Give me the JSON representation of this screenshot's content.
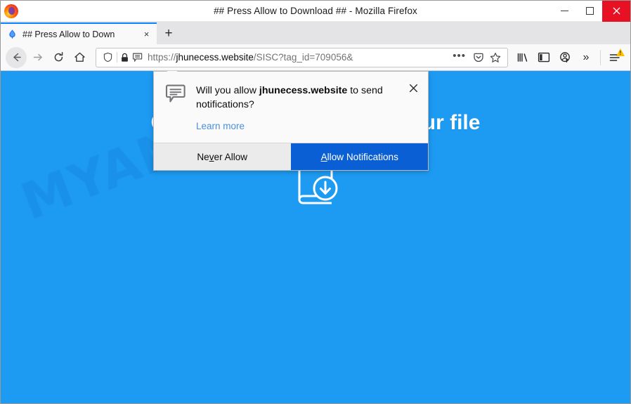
{
  "window": {
    "title": "## Press Allow to Download ## - Mozilla Firefox",
    "app_icon": "firefox-logo",
    "controls": {
      "minimize": "minimize",
      "maximize": "maximize",
      "close": "close"
    }
  },
  "tabs": {
    "items": [
      {
        "title": "## Press Allow to Down",
        "favicon": "blue-droplet-favicon",
        "close_label": "×"
      }
    ],
    "new_tab_label": "+"
  },
  "navigation": {
    "back": "back-arrow",
    "forward": "forward-arrow",
    "reload": "reload",
    "home": "home"
  },
  "urlbar": {
    "shield_icon": "tracking-protection-shield",
    "lock_icon": "padlock",
    "permission_icon": "notification-speech-bubble",
    "scheme": "https://",
    "domain": "jhunecess.website",
    "path": "/SISC?tag_id=709056&",
    "full_url": "https://jhunecess.website/SISC?tag_id=709056&",
    "page_actions": "•••",
    "pocket_icon": "pocket",
    "bookmark_icon": "star"
  },
  "toolbar_right": {
    "library": "library-icon",
    "sidebar": "sidebar-icon",
    "account": "account-sync-warning-icon",
    "overflow": "»",
    "menu": "hamburger-menu-icon",
    "menu_badge": "update-warning-badge"
  },
  "doorhanger": {
    "icon": "notification-speech-bubble",
    "question_prefix": "Will you allow ",
    "question_domain": "jhunecess.website",
    "question_suffix": " to send notifications?",
    "learn_more": "Learn more",
    "close": "×",
    "never_allow": {
      "before": "Ne",
      "accel": "v",
      "after": "er Allow"
    },
    "allow": {
      "accel": "A",
      "after": "llow Notifications"
    }
  },
  "page": {
    "background_color": "#1d9bf3",
    "headline_line1_visible": "y",
    "headline_line2": "Click Allow to download your file",
    "headline_full": "Click Allow to download your file",
    "book_download_icon": "book-download-icon",
    "watermark": "MYANTISPYWARE.COM"
  }
}
